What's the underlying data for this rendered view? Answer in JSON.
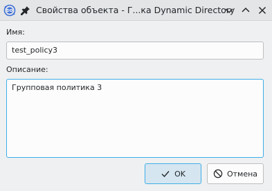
{
  "window": {
    "title": "Свойства объекта - Г...ка Dynamic Directory"
  },
  "form": {
    "name_label": "Имя:",
    "name_value": "test_policy3",
    "description_label": "Описание:",
    "description_value": "Групповая политика 3"
  },
  "buttons": {
    "ok_label": "OK",
    "cancel_label": "Отмена"
  },
  "colors": {
    "accent": "#3daee9",
    "background": "#eff0f1",
    "app_icon": "#3d6fd6"
  },
  "icons": {
    "app": "dynamic-directory-icon",
    "pin": "pin-icon",
    "minimize": "chevron-down-icon",
    "maximize": "chevron-up-icon",
    "close": "close-icon",
    "ok": "checkmark-icon",
    "cancel": "cancel-icon"
  }
}
